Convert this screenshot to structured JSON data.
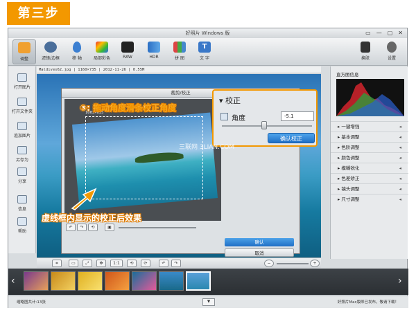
{
  "step_label": "第三步",
  "window_title": "好照片 Windows 版",
  "window_controls": [
    "▭",
    "—",
    "▢",
    "✕"
  ],
  "toolbar": {
    "tools": [
      "调整",
      "滤镜/边框",
      "移 轴",
      "局部彩色",
      "RAW",
      "HDR",
      "拼 图",
      "文 字"
    ],
    "right_tools": [
      "换肤",
      "设置"
    ]
  },
  "sidebar": {
    "items": [
      "打开图片",
      "打开文件夹",
      "追加图片",
      "另存为",
      "分享",
      "信息",
      "帮助"
    ]
  },
  "info_bar": "Maldives62.jpg | 1160×735 | 2012-11-26 | 0.55M",
  "crop_dialog": {
    "title": "裁剪/校正",
    "dimension": "1003×635",
    "ok_label": "确认",
    "cancel_label": "取消"
  },
  "correction_popup": {
    "title": "校正",
    "angle_label": "角度",
    "angle_value": "-5.1",
    "confirm_label": "确认校正",
    "angle_level_percent": 47
  },
  "annotations": {
    "step_hint": "③: 拖动角度滑条校正角度",
    "result_hint": "虚线框内显示的校正后效果"
  },
  "watermark": "三联网 3LIAN.COM",
  "right_panel": {
    "histogram_title": "直方图信息",
    "adjustments": [
      "一键增强",
      "基本调整",
      "色阶调整",
      "颜色调整",
      "模糊锐化",
      "色差矫正",
      "镜头调整",
      "尺寸调整"
    ]
  },
  "bottom_tools": [
    "1:1"
  ],
  "status": {
    "thumbnail_count": "缩略图共计:13张",
    "news": "好照片Mac版即已发布，敬请下载！"
  },
  "colors": {
    "accent_orange": "#f39800",
    "confirm_blue": "#2b7fd6"
  }
}
